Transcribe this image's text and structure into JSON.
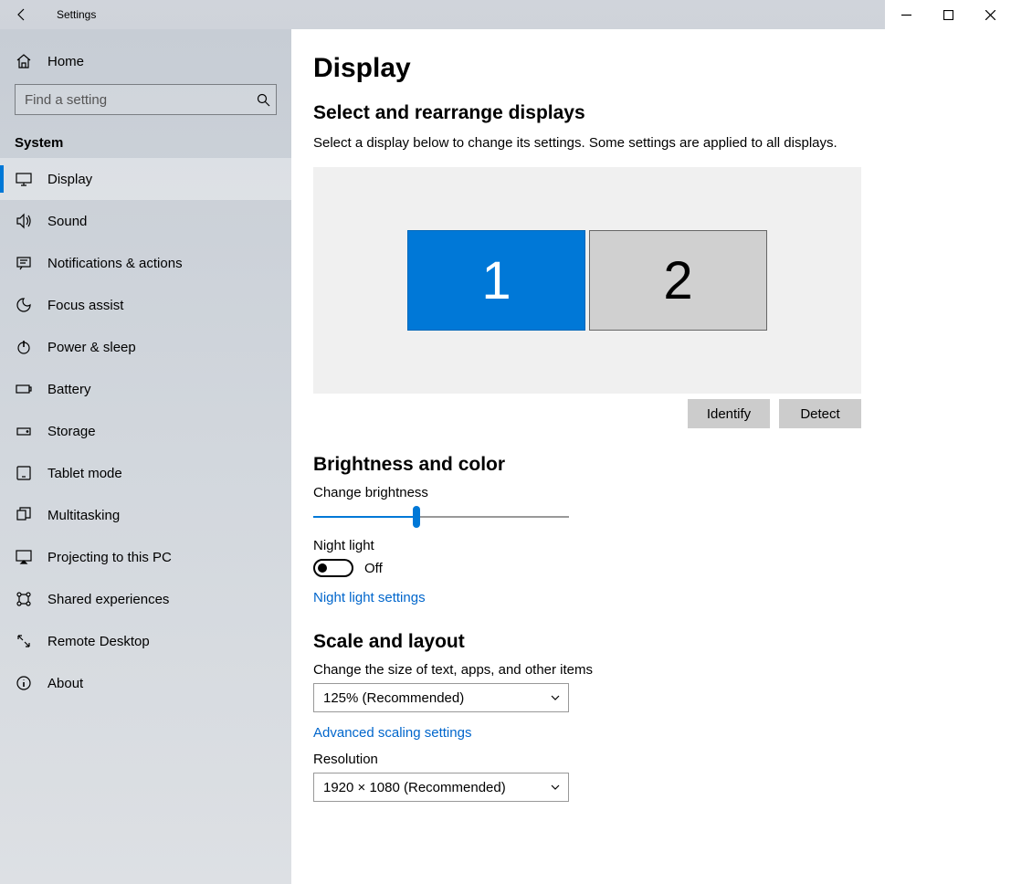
{
  "titlebar": {
    "title": "Settings"
  },
  "sidebar": {
    "home": "Home",
    "search": {
      "placeholder": "Find a setting"
    },
    "section": "System",
    "items": [
      {
        "label": "Display",
        "icon": "monitor-icon",
        "active": true
      },
      {
        "label": "Sound",
        "icon": "sound-icon"
      },
      {
        "label": "Notifications & actions",
        "icon": "notifications-icon"
      },
      {
        "label": "Focus assist",
        "icon": "focus-icon"
      },
      {
        "label": "Power & sleep",
        "icon": "power-icon"
      },
      {
        "label": "Battery",
        "icon": "battery-icon"
      },
      {
        "label": "Storage",
        "icon": "storage-icon"
      },
      {
        "label": "Tablet mode",
        "icon": "tablet-icon"
      },
      {
        "label": "Multitasking",
        "icon": "multitask-icon"
      },
      {
        "label": "Projecting to this PC",
        "icon": "projecting-icon"
      },
      {
        "label": "Shared experiences",
        "icon": "shared-icon"
      },
      {
        "label": "Remote Desktop",
        "icon": "remote-icon"
      },
      {
        "label": "About",
        "icon": "about-icon"
      }
    ]
  },
  "main": {
    "page_title": "Display",
    "rearrange": {
      "heading": "Select and rearrange displays",
      "desc": "Select a display below to change its settings. Some settings are applied to all displays.",
      "displays": [
        {
          "label": "1",
          "selected": true
        },
        {
          "label": "2",
          "selected": false
        }
      ],
      "identify": "Identify",
      "detect": "Detect"
    },
    "brightness": {
      "heading": "Brightness and color",
      "change_label": "Change brightness",
      "value": 40,
      "night_light_label": "Night light",
      "night_light_state": "Off",
      "night_light_link": "Night light settings"
    },
    "scale": {
      "heading": "Scale and layout",
      "size_label": "Change the size of text, apps, and other items",
      "size_value": "125% (Recommended)",
      "advanced_link": "Advanced scaling settings",
      "resolution_label": "Resolution",
      "resolution_value": "1920 × 1080 (Recommended)"
    }
  }
}
